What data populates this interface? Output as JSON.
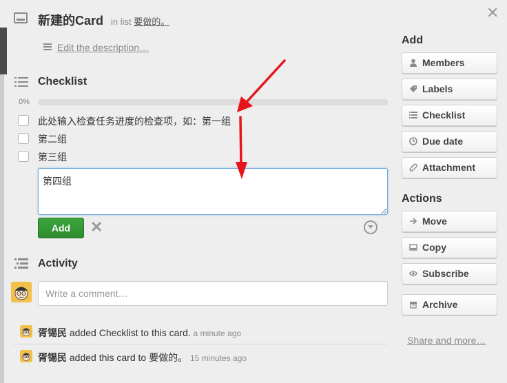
{
  "card": {
    "title": "新建的Card",
    "in_list_prefix": "in list",
    "list_name": "要做的。",
    "close_symbol": "✕",
    "description_link": "Edit the description…"
  },
  "checklist": {
    "heading": "Checklist",
    "progress_label": "0%",
    "progress_value": 0,
    "items": [
      {
        "text": "此处输入检查任务进度的检查项，如：第一组",
        "checked": false
      },
      {
        "text": "第二组",
        "checked": false
      },
      {
        "text": "第三组",
        "checked": false
      }
    ],
    "new_item_value": "第四组",
    "add_label": "Add",
    "cancel_symbol": "✕"
  },
  "activity": {
    "heading": "Activity",
    "comment_placeholder": "Write a comment…",
    "entries": [
      {
        "user": "胥锡民",
        "action": "added Checklist to this card.",
        "time": "a minute ago"
      },
      {
        "user": "胥锡民",
        "action": "added this card to 要做的。",
        "time": "15 minutes ago"
      }
    ]
  },
  "sidebar": {
    "add_heading": "Add",
    "add_buttons": [
      {
        "label": "Members",
        "icon": "person-icon"
      },
      {
        "label": "Labels",
        "icon": "tag-icon"
      },
      {
        "label": "Checklist",
        "icon": "checklist-icon"
      },
      {
        "label": "Due date",
        "icon": "clock-icon"
      },
      {
        "label": "Attachment",
        "icon": "paperclip-icon"
      }
    ],
    "actions_heading": "Actions",
    "action_buttons": [
      {
        "label": "Move",
        "icon": "arrow-right-icon"
      },
      {
        "label": "Copy",
        "icon": "card-icon"
      },
      {
        "label": "Subscribe",
        "icon": "eye-icon"
      },
      {
        "label": "Archive",
        "icon": "archive-icon"
      }
    ],
    "share_link": "Share and more…"
  },
  "colors": {
    "add_button": "#2e8b2e",
    "annotation_arrow": "#e8141b",
    "avatar": "#f3c14a"
  }
}
